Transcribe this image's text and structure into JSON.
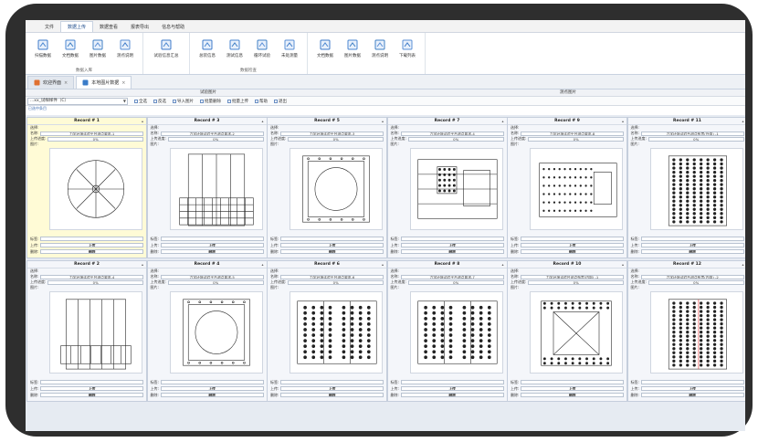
{
  "menu": {
    "tabs": [
      "文件",
      "数据上传",
      "数据查看",
      "报表导出",
      "信息与帮助"
    ],
    "active_index": 1
  },
  "ribbon": {
    "groups": [
      {
        "name": "数据入库",
        "buttons": [
          "扫描数据",
          "文档数据",
          "图片数据",
          "测点说明"
        ]
      },
      {
        "name": "",
        "buttons": [
          "试验信息汇总"
        ]
      },
      {
        "name": "数据检查",
        "buttons": [
          "总装信息",
          "测试信息",
          "循环试验",
          "未处测量"
        ]
      },
      {
        "name": "",
        "buttons": [
          "文档数据",
          "图片数据",
          "测点说明",
          "下载列表"
        ]
      }
    ]
  },
  "doc_tabs": [
    {
      "label": "欢迎界面",
      "icon": "home-icon",
      "active": false
    },
    {
      "label": "本地图片数据",
      "icon": "image-icon",
      "active": true
    }
  ],
  "pane_heads": {
    "left": "试验图片",
    "right": "测点图片"
  },
  "toolbar": {
    "combo_value": "...xx_试样样件（C）",
    "buttons": [
      {
        "label": "全选",
        "icon": "select-all-icon"
      },
      {
        "label": "反选",
        "icon": "invert-select-icon"
      },
      {
        "label": "导入图片",
        "icon": "import-icon"
      },
      {
        "label": "批量删除",
        "icon": "delete-icon"
      },
      {
        "label": "批量上传",
        "icon": "upload-icon"
      },
      {
        "label": "帮助",
        "icon": "help-icon"
      },
      {
        "label": "退出",
        "icon": "exit-icon"
      }
    ]
  },
  "sub_note": "已选中条目",
  "field_labels": {
    "select": "选择:",
    "name": "名称:",
    "upload_progress": "上传进度:",
    "image": "图片:",
    "mark": "标签:",
    "upload": "上传:",
    "delete": "删除:"
  },
  "upload_button_label": "上传",
  "delete_button_label": "删除",
  "cards": [
    {
      "title": "Record # 1",
      "name": "力学环境试验平台测点要求-1",
      "progress": "0%",
      "drawing": "circle-fixture",
      "highlight": true
    },
    {
      "title": "Record # 2",
      "name": "力学环境试验平台测点要求-4",
      "progress": "0%",
      "drawing": "tall-frame"
    },
    {
      "title": "Record # 3",
      "name": "力学环境试验平台测点要求-2",
      "progress": "0%",
      "drawing": "frame-structure"
    },
    {
      "title": "Record # 4",
      "name": "力学环境试验平台测点要求-5",
      "progress": "0%",
      "drawing": "square-ring"
    },
    {
      "title": "Record # 5",
      "name": "力学环境试验平台测点要求-3",
      "progress": "0%",
      "drawing": "square-ring-small"
    },
    {
      "title": "Record # 6",
      "name": "力学环境试验平台测点要求-6",
      "progress": "0%",
      "drawing": "dense-grid"
    },
    {
      "title": "Record # 7",
      "name": "力学环境试验平台测点要求-4",
      "progress": "0%",
      "drawing": "board-layout"
    },
    {
      "title": "Record # 8",
      "name": "力学环境试验平台测点要求-7",
      "progress": "0%",
      "drawing": "dense-grid"
    },
    {
      "title": "Record # 9",
      "name": "力学环境试验平台测点要求-8",
      "progress": "0%",
      "drawing": "board-labels"
    },
    {
      "title": "Record # 10",
      "name": "力学环境试验台测点布置(内部) -1",
      "progress": "0%",
      "drawing": "square-frame-cam"
    },
    {
      "title": "Record # 11",
      "name": "力学环境试验台测点布置(外部) -1",
      "progress": "0%",
      "drawing": "dense-cam"
    },
    {
      "title": "Record # 12",
      "name": "力学环境试验台测点布置(内部) -2",
      "progress": "0%",
      "drawing": "dense-cam-red"
    }
  ]
}
